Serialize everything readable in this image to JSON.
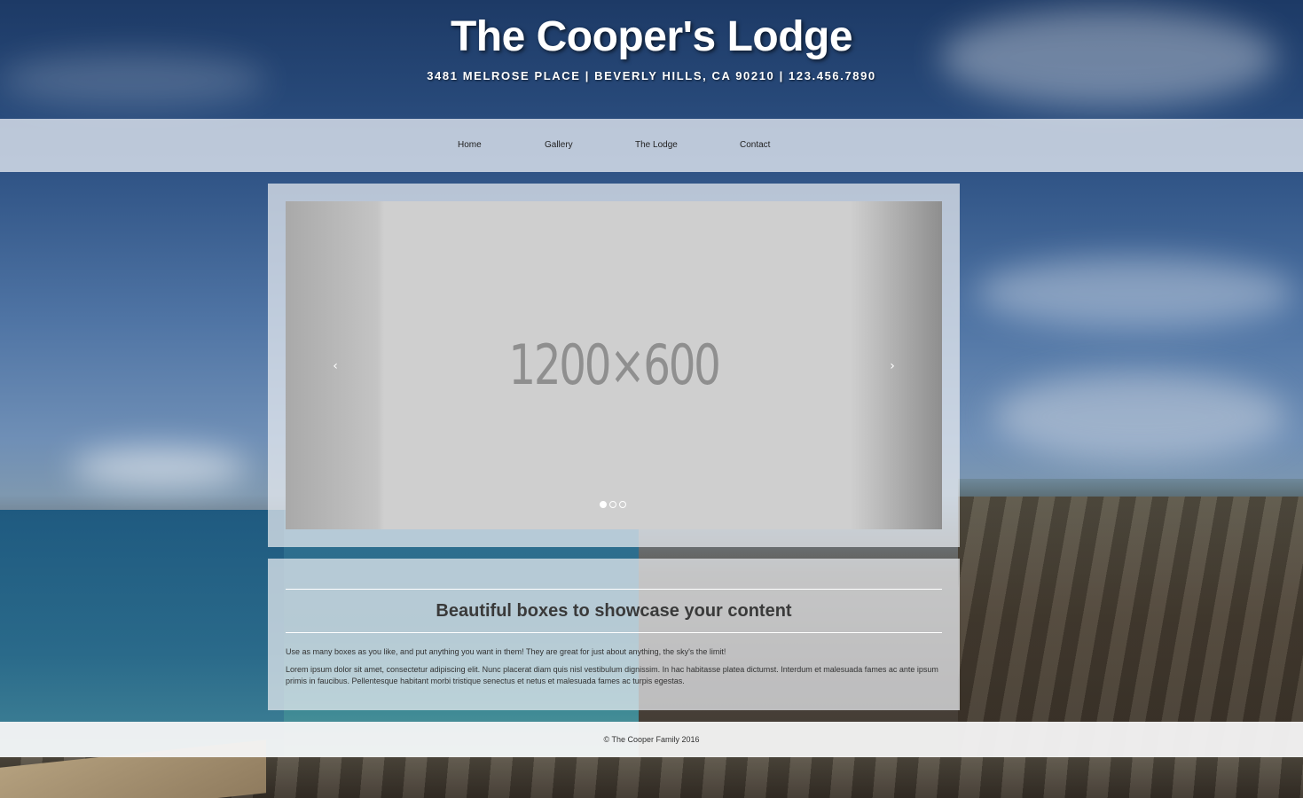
{
  "site": {
    "title": "The Cooper's Lodge",
    "subtitle": "3481 MELROSE PLACE | BEVERLY HILLS, CA 90210 | 123.456.7890"
  },
  "nav": {
    "items": [
      {
        "label": "Home"
      },
      {
        "label": "Gallery"
      },
      {
        "label": "The Lodge"
      },
      {
        "label": "Contact"
      }
    ]
  },
  "slider": {
    "placeholder_text": "1200×600",
    "prev_icon": "‹",
    "next_icon": "›",
    "slide_count": 3,
    "active_slide": 1
  },
  "content_box": {
    "title": "Beautiful boxes to showcase your content",
    "paragraph_1": "Use as many boxes as you like, and put anything you want in them! They are great for just about anything, the sky's the limit!",
    "paragraph_2": "Lorem ipsum dolor sit amet, consectetur adipiscing elit. Nunc placerat diam quis nisl vestibulum dignissim. In hac habitasse platea dictumst. Interdum et malesuada fames ac ante ipsum primis in faucibus. Pellentesque habitant morbi tristique senectus et netus et malesuada fames ac turpis egestas."
  },
  "footer": {
    "text": "© The Cooper Family 2016"
  },
  "colors": {
    "title_text": "#ffffff",
    "nav_bg": "#e6ebf2",
    "panel_bg": "#ebeef2",
    "placeholder_bg": "#cfcfcf",
    "placeholder_text": "#8f8f8f"
  }
}
